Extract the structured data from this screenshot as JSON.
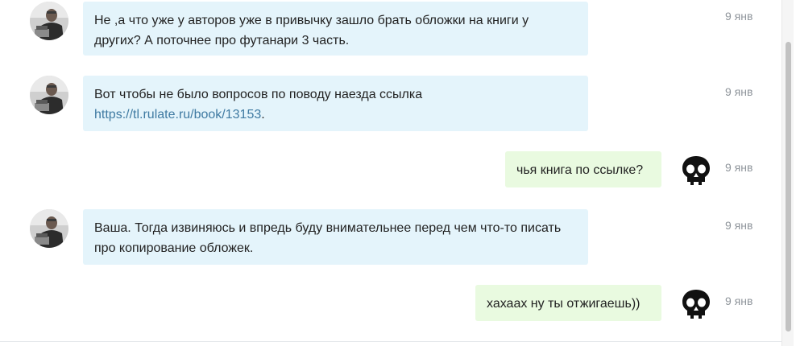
{
  "messages": [
    {
      "direction": "incoming",
      "avatar_icon": "user-portrait-avatar",
      "text": "Не ,а что уже у авторов уже в привычку зашло брать обложки на книги у других? А поточнее про футанари 3 часть.",
      "time": "9 янв"
    },
    {
      "direction": "incoming",
      "avatar_icon": "user-portrait-avatar",
      "text_before_link": "Вот чтобы не было вопросов по поводу наезда ссылка ",
      "link": "https://tl.rulate.ru/book/13153",
      "text_after_link": ".",
      "time": "9 янв"
    },
    {
      "direction": "outgoing",
      "avatar_icon": "skull-avatar",
      "text": "чья книга по ссылке?",
      "time": "9 янв"
    },
    {
      "direction": "incoming",
      "avatar_icon": "user-portrait-avatar",
      "text": "Ваша. Тогда извиняюсь и впредь буду внимательнее перед чем что-то писать про копирование обложек.",
      "time": "9 янв"
    },
    {
      "direction": "outgoing",
      "avatar_icon": "skull-avatar",
      "text": "хахаах ну ты отжигаешь))",
      "time": "9 янв"
    }
  ],
  "colors": {
    "incoming_bubble": "#e4f4fb",
    "outgoing_bubble": "#e9fae0",
    "link": "#3f7aa2",
    "time": "#8f959b"
  }
}
